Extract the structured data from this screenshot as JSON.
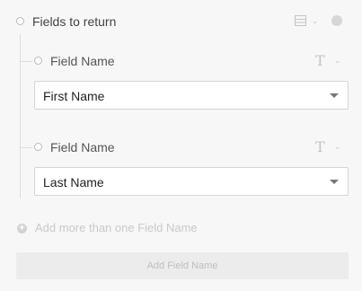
{
  "header": {
    "title": "Fields to return",
    "list_icon": "list-icon",
    "info_icon": "info-icon"
  },
  "fields": [
    {
      "label": "Field Name",
      "value": "First Name",
      "type_icon": "T"
    },
    {
      "label": "Field Name",
      "value": "Last Name",
      "type_icon": "T"
    }
  ],
  "add_more": {
    "label": "Add more than one Field Name"
  },
  "add_button": {
    "label": "Add Field Name"
  },
  "colors": {
    "background": "#f7f7f7",
    "muted": "#c9c9c9",
    "border": "#d5d5d5"
  }
}
